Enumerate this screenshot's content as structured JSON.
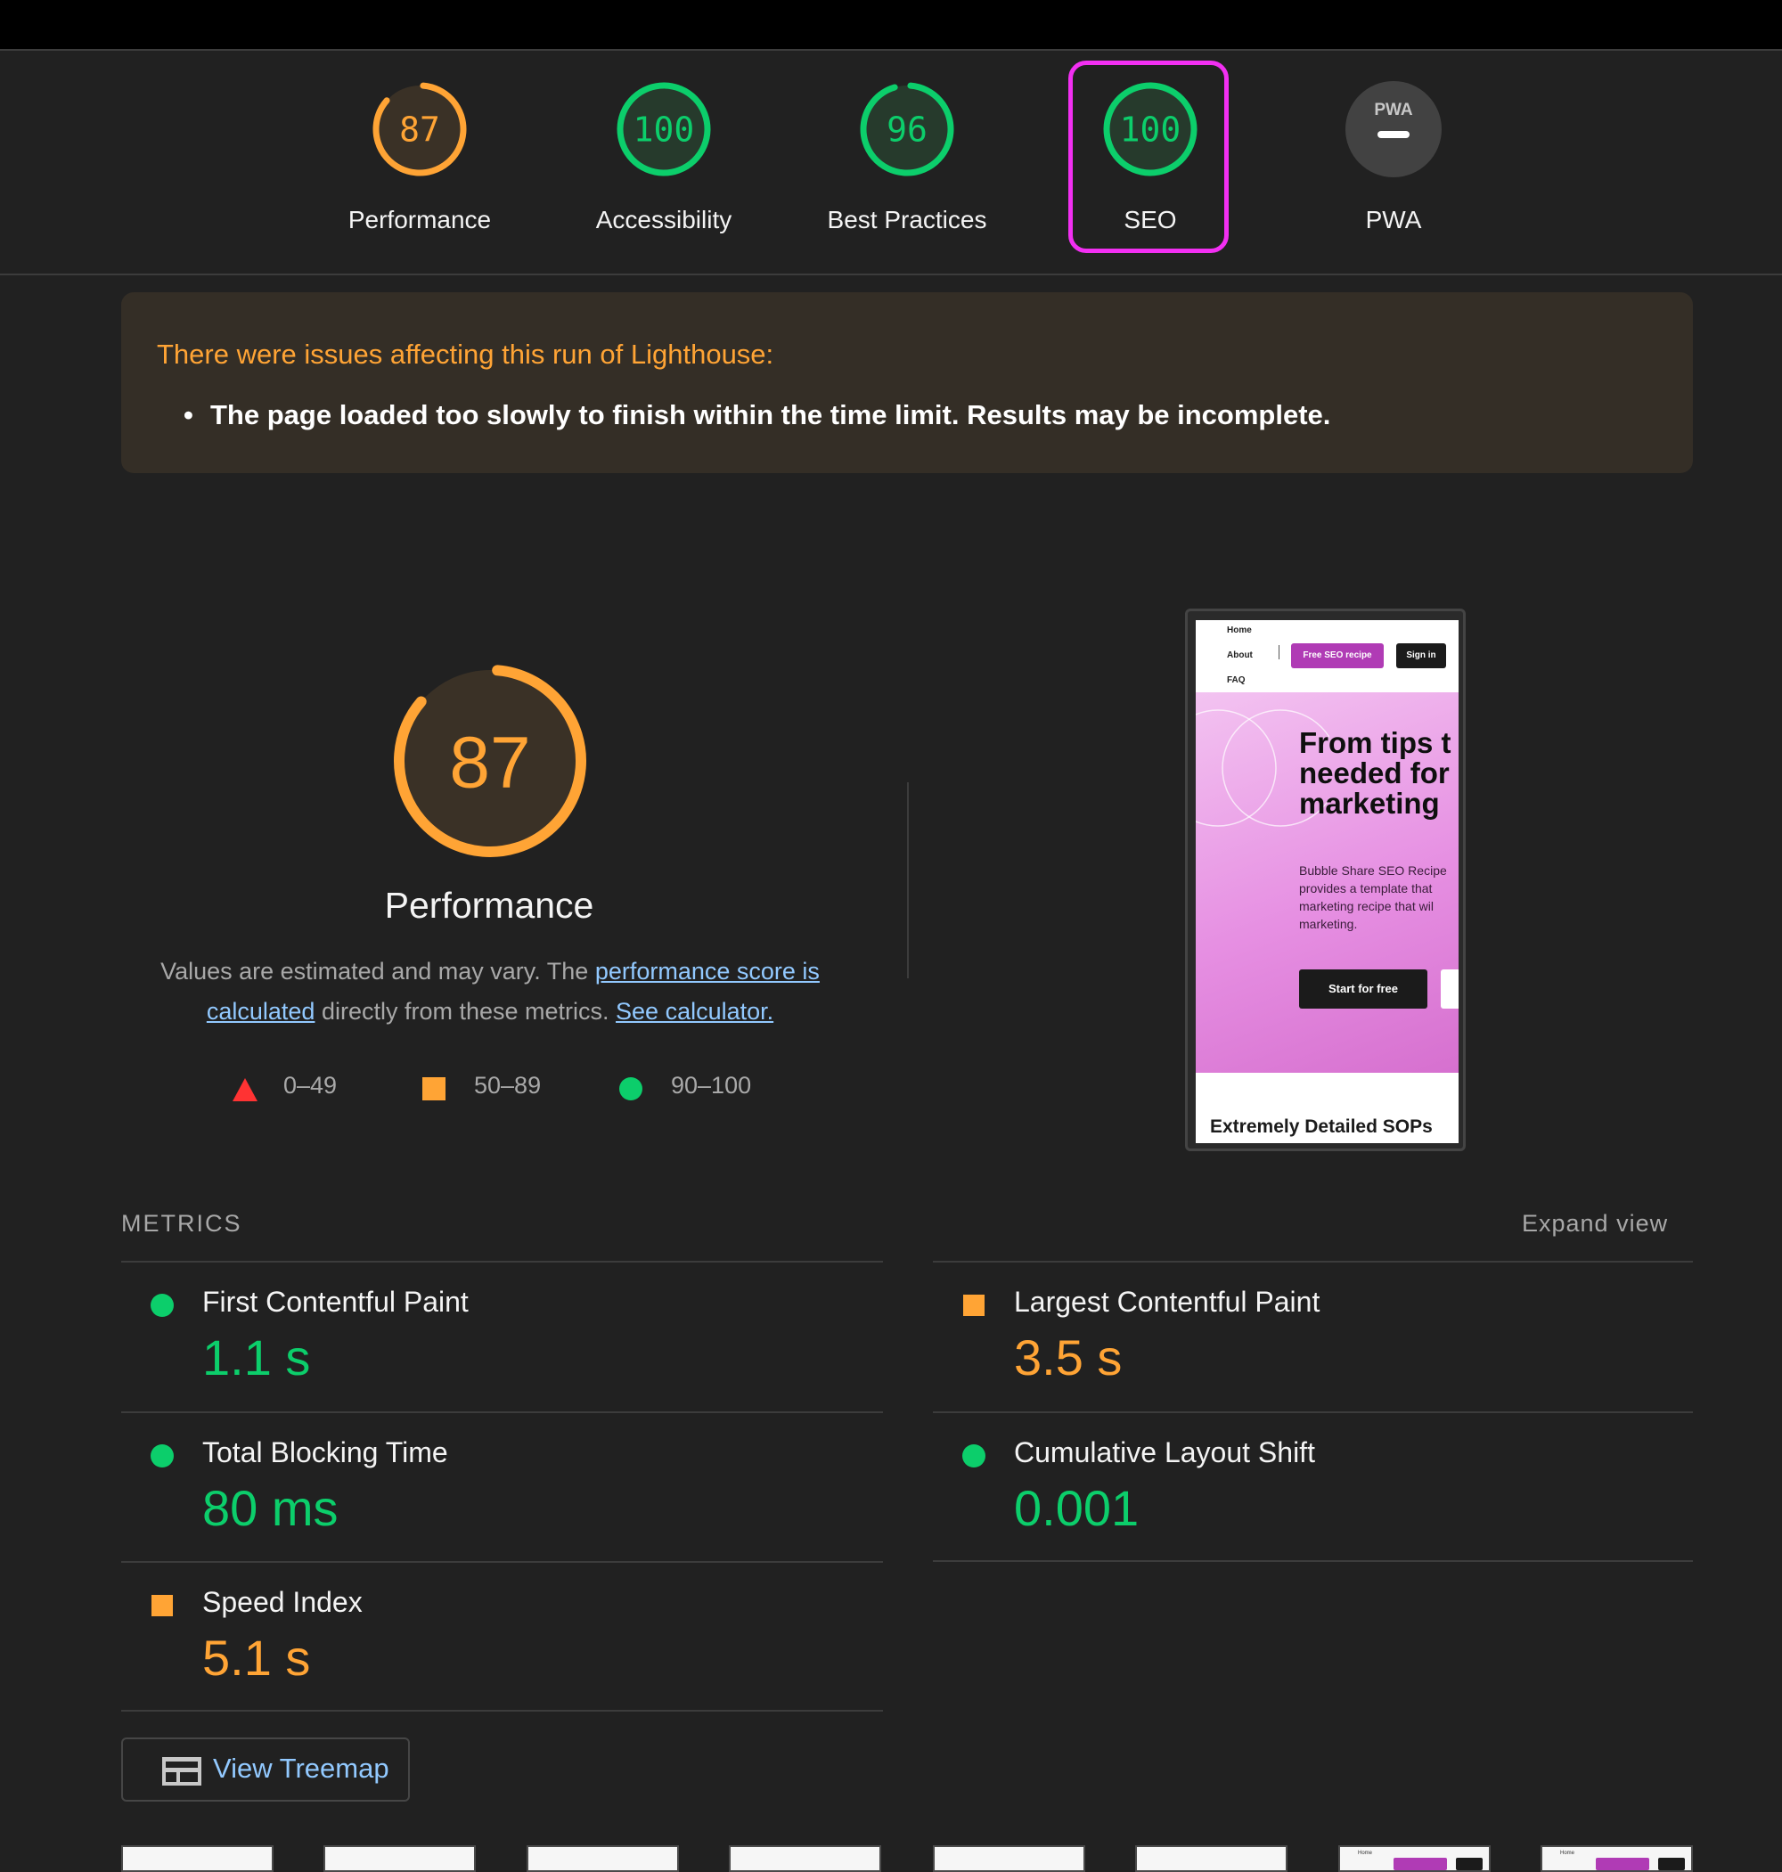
{
  "colors": {
    "pass": "#0cce6b",
    "average": "#ffa435",
    "fail": "#ff3333",
    "na": "#9e9e9e",
    "highlight": "#f22ff2",
    "link": "#92c9ff"
  },
  "categories": [
    {
      "label": "Performance",
      "score": 87,
      "rating": "average"
    },
    {
      "label": "Accessibility",
      "score": 100,
      "rating": "pass"
    },
    {
      "label": "Best Practices",
      "score": 96,
      "rating": "pass"
    },
    {
      "label": "SEO",
      "score": 100,
      "rating": "pass",
      "highlighted": true
    },
    {
      "label": "PWA",
      "score": null,
      "rating": "na",
      "badge_text": "PWA"
    }
  ],
  "warning": {
    "title": "There were issues affecting this run of Lighthouse:",
    "items": [
      "The page loaded too slowly to finish within the time limit. Results may be incomplete."
    ]
  },
  "performance": {
    "score": 87,
    "title": "Performance",
    "desc_prefix": "Values are estimated and may vary. The ",
    "desc_link1": "performance score is calculated",
    "desc_middle": " directly from these metrics. ",
    "desc_link2": "See calculator.",
    "legend": [
      {
        "shape": "triangle",
        "range": "0–49"
      },
      {
        "shape": "square",
        "range": "50–89"
      },
      {
        "shape": "circle",
        "range": "90–100"
      }
    ]
  },
  "screenshot": {
    "nav": [
      "Home",
      "About",
      "FAQ"
    ],
    "cta": "Free SEO recipe",
    "signin": "Sign in",
    "headline_lines": [
      "From tips t",
      "needed for",
      "marketing"
    ],
    "body": "Bubble Share SEO Recipe\nprovides a template that\nmarketing recipe that wil\nmarketing.",
    "start_button": "Start for free",
    "footer_title": "Extremely Detailed SOPs"
  },
  "metrics": {
    "header": "METRICS",
    "expand_label": "Expand view",
    "items": [
      {
        "label": "First Contentful Paint",
        "value": "1.1 s",
        "rating": "pass"
      },
      {
        "label": "Largest Contentful Paint",
        "value": "3.5 s",
        "rating": "average"
      },
      {
        "label": "Total Blocking Time",
        "value": "80 ms",
        "rating": "pass"
      },
      {
        "label": "Cumulative Layout Shift",
        "value": "0.001",
        "rating": "pass"
      },
      {
        "label": "Speed Index",
        "value": "5.1 s",
        "rating": "average"
      }
    ]
  },
  "treemap": {
    "label": "View Treemap",
    "icon": "treemap-icon"
  },
  "filmstrip": {
    "thumbnails": 8,
    "home_label": "Home"
  }
}
